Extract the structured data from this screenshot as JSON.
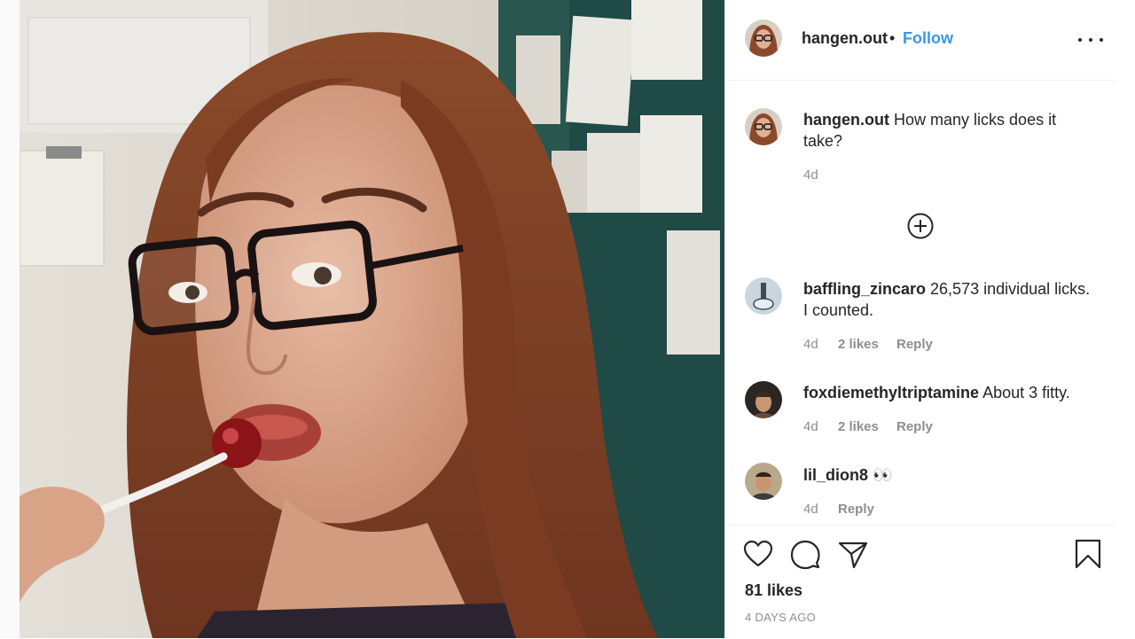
{
  "post": {
    "username": "hangen.out",
    "separator": "•",
    "follow_label": "Follow",
    "more_icon": "more-options-icon",
    "caption": {
      "username": "hangen.out",
      "text": "How many licks does it take?",
      "age": "4d"
    },
    "load_more_icon": "plus-circle-icon",
    "comments": [
      {
        "username": "baffling_zincaro",
        "text": "26,573 individual licks. I counted.",
        "age": "4d",
        "likes": "2 likes",
        "reply": "Reply"
      },
      {
        "username": "foxdiemethyltriptamine",
        "text": "About 3 fitty.",
        "age": "4d",
        "likes": "2 likes",
        "reply": "Reply"
      },
      {
        "username": "lil_dion8",
        "text": "👀",
        "age": "4d",
        "reply": "Reply"
      }
    ],
    "actions": {
      "like_icon": "heart-icon",
      "comment_icon": "comment-icon",
      "share_icon": "share-icon",
      "save_icon": "bookmark-icon"
    },
    "likes_count": "81 likes",
    "date": "4 DAYS AGO"
  },
  "colors": {
    "accent": "#3897f0",
    "text": "#262626",
    "muted": "#8e8e8e",
    "divider": "#efefef"
  }
}
